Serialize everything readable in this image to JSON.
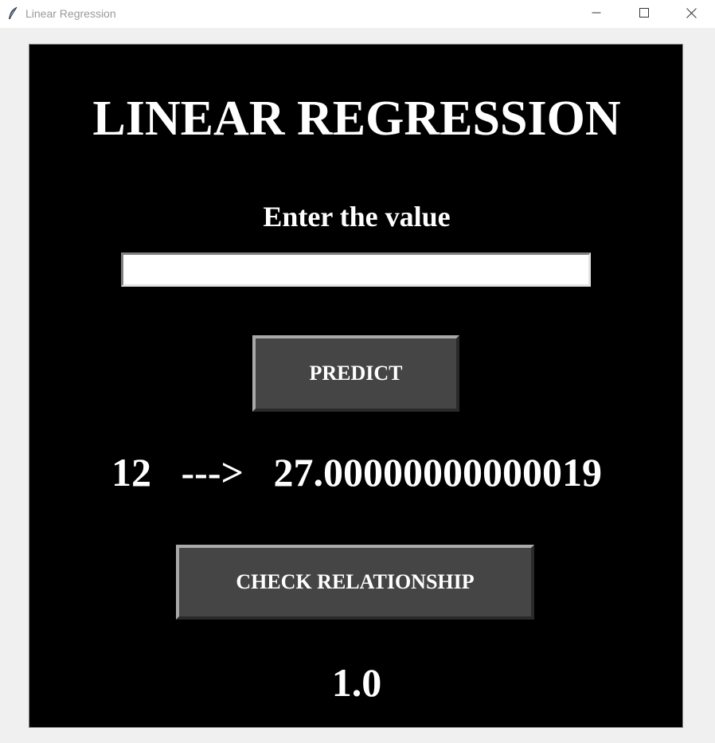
{
  "window": {
    "title": "Linear Regression",
    "icon": "feather-icon",
    "controls": [
      "minimize-icon",
      "maximize-icon",
      "close-icon"
    ]
  },
  "main": {
    "heading": "LINEAR REGRESSION",
    "input_label": "Enter the value",
    "input_value": "",
    "predict_label": "PREDICT",
    "result": "12   --->   27.00000000000019",
    "check_label": "CHECK RELATIONSHIP",
    "relationship_value": "1.0"
  },
  "colors": {
    "canvas_background": "#000000",
    "text": "#ffffff",
    "button_background": "#454545",
    "window_background": "#f0f0f0"
  }
}
